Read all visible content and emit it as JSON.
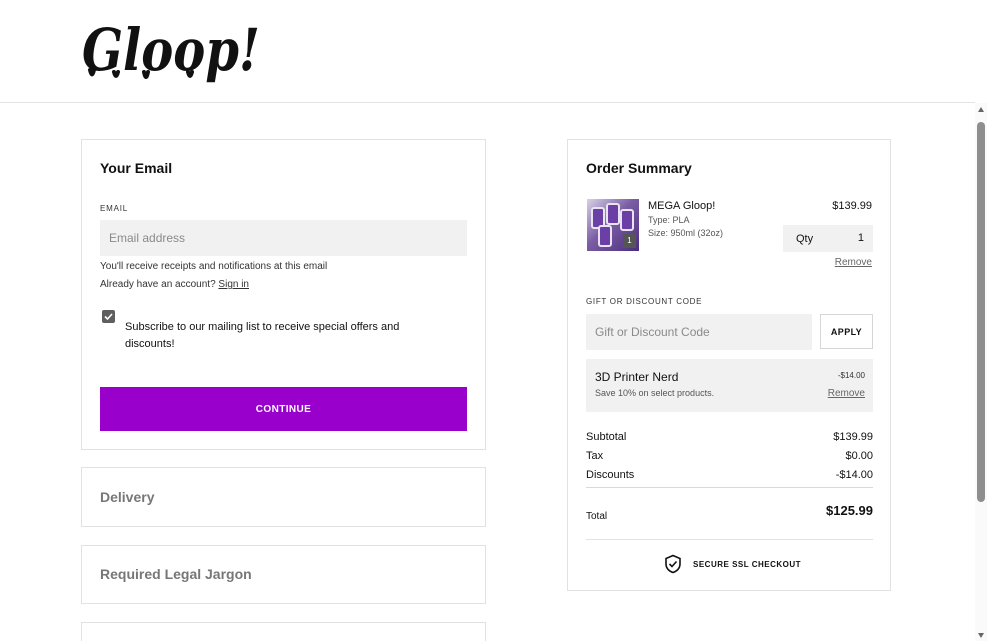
{
  "brand": {
    "logo_text": "Gloop!"
  },
  "email_section": {
    "title": "Your Email",
    "field_label": "EMAIL",
    "placeholder": "Email address",
    "value": "",
    "help_receipts": "You'll receive receipts and notifications at this email",
    "help_account": "Already have an account?",
    "sign_in_link": "Sign in",
    "subscribe_checked": true,
    "subscribe_label": "Subscribe to our mailing list to receive special offers and discounts!",
    "continue_label": "CONTINUE"
  },
  "sections": {
    "delivery": "Delivery",
    "legal": "Required Legal Jargon"
  },
  "order_summary": {
    "title": "Order Summary",
    "item": {
      "name": "MEGA Gloop!",
      "type": "Type: PLA",
      "size": "Size: 950ml (32oz)",
      "price": "$139.99",
      "qty_label": "Qty",
      "qty": "1",
      "badge": "1",
      "remove_label": "Remove"
    },
    "gift": {
      "label": "GIFT OR DISCOUNT CODE",
      "placeholder": "Gift or Discount Code",
      "apply_label": "APPLY"
    },
    "discount": {
      "name": "3D Printer Nerd",
      "description": "Save 10% on select products.",
      "amount": "-$14.00",
      "remove_label": "Remove"
    },
    "totals": {
      "subtotal_label": "Subtotal",
      "subtotal": "$139.99",
      "tax_label": "Tax",
      "tax": "$0.00",
      "discounts_label": "Discounts",
      "discounts": "-$14.00",
      "total_label": "Total",
      "total": "$125.99"
    },
    "secure_label": "SECURE SSL CHECKOUT"
  },
  "colors": {
    "accent": "#9900cc",
    "field_bg": "#f1f1f1"
  },
  "icons": [
    "gloop-logo",
    "checkbox-check-icon",
    "shield-check-icon",
    "product-thumbnail"
  ]
}
